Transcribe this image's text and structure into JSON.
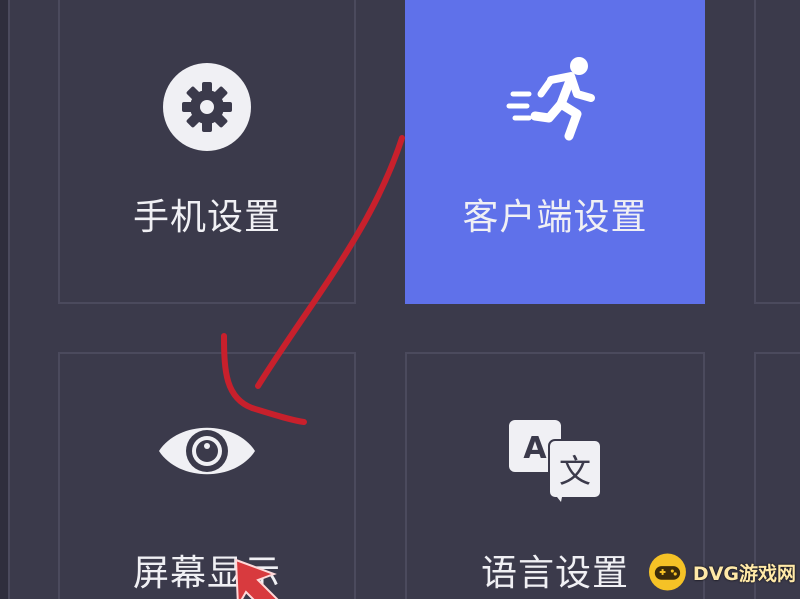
{
  "settings_grid": {
    "tiles": [
      {
        "label": "手机设置",
        "icon": "gear-icon",
        "selected": false
      },
      {
        "label": "客户端设置",
        "icon": "running-person-icon",
        "selected": true
      },
      {
        "label": "屏幕显示",
        "icon": "eye-icon",
        "selected": false
      },
      {
        "label": "语言设置",
        "icon": "translate-icon",
        "selected": false
      }
    ]
  },
  "watermark": {
    "text": "DVG游戏网",
    "icon": "game-controller-logo-icon"
  },
  "colors": {
    "background": "#3b3a4b",
    "tile_border": "#4b4a5d",
    "accent": "#5f71ea",
    "text": "#f0f0f4",
    "annotation": "#c8202c"
  }
}
